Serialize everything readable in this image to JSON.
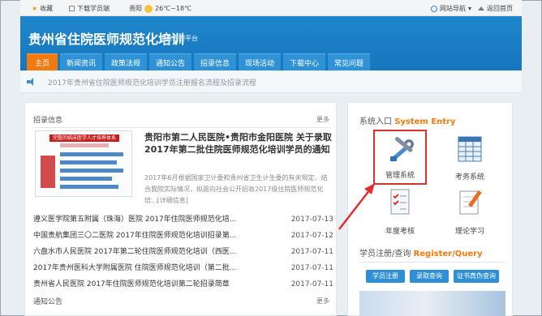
{
  "topbar": {
    "favorite": "收藏",
    "download": "下载学员端",
    "weather_city": "贵阳",
    "temperature": "26℃~18℃",
    "site_nav": "网站导航",
    "home": "返回首页"
  },
  "header": {
    "title": "贵州省住院医师规范化培训",
    "subtitle": "信息管理平台"
  },
  "nav": {
    "tabs": [
      "主页",
      "新闻资讯",
      "政策法规",
      "通知公告",
      "招录信息",
      "现场活动",
      "下载中心",
      "常见问题"
    ]
  },
  "notice": {
    "text": "2017年贵州省住院医师规范化培训学员注册报名流程及招录流程"
  },
  "recruit": {
    "heading": "招录信息",
    "more": "更多",
    "image_banner": "完整的临床医学人才培养体系",
    "feature_title": "贵阳市第二人民医院•贵阳市金阳医院 关于录取2017年第二批住院医师规范化培训学员的通知",
    "feature_desc": "2017年6月根据国家卫计委和贵州省卫生计生委的有关规定，结合我院实际情况，拟面向社会公开招收2017级住院医师规范化培...[详细信息]",
    "items": [
      {
        "title": "遵义医学院第五附属（珠海）医院 2017年住院医师规范化培...",
        "date": "2017-07-13"
      },
      {
        "title": "中国贵航集团三〇二医院 2017年住院医师规范化培训招录第...",
        "date": "2017-07-12"
      },
      {
        "title": "六盘水市人民医院 2017年第二轮住院医师规范化培训（西医...",
        "date": "2017-07-11"
      },
      {
        "title": "2017年贵州医科大学附属医院 住院医师规范化培训（第二批...",
        "date": "2017-07-11"
      },
      {
        "title": "贵州省人民医院 2017年住院医师规范化培训第二轮招录简章",
        "date": "2017-07-11"
      }
    ],
    "notice_heading": "通知公告",
    "notice_more": "更多"
  },
  "entry": {
    "heading_cn": "系统入口",
    "heading_en": "System Entry",
    "tiles": [
      {
        "label": "管理系统",
        "icon": "tools-icon"
      },
      {
        "label": "考务系统",
        "icon": "spreadsheet-icon"
      },
      {
        "label": "年度考核",
        "icon": "checklist-icon"
      },
      {
        "label": "理论学习",
        "icon": "notebook-icon"
      }
    ]
  },
  "register": {
    "heading_cn": "学员注册/查询",
    "heading_en": "Register/Query",
    "buttons": [
      "学员注册",
      "录取查询",
      "证书真伪查询"
    ]
  },
  "colors": {
    "header_blue": "#1b7fc4",
    "nav_active": "#f07a0e",
    "highlight_red": "#e0302e"
  }
}
